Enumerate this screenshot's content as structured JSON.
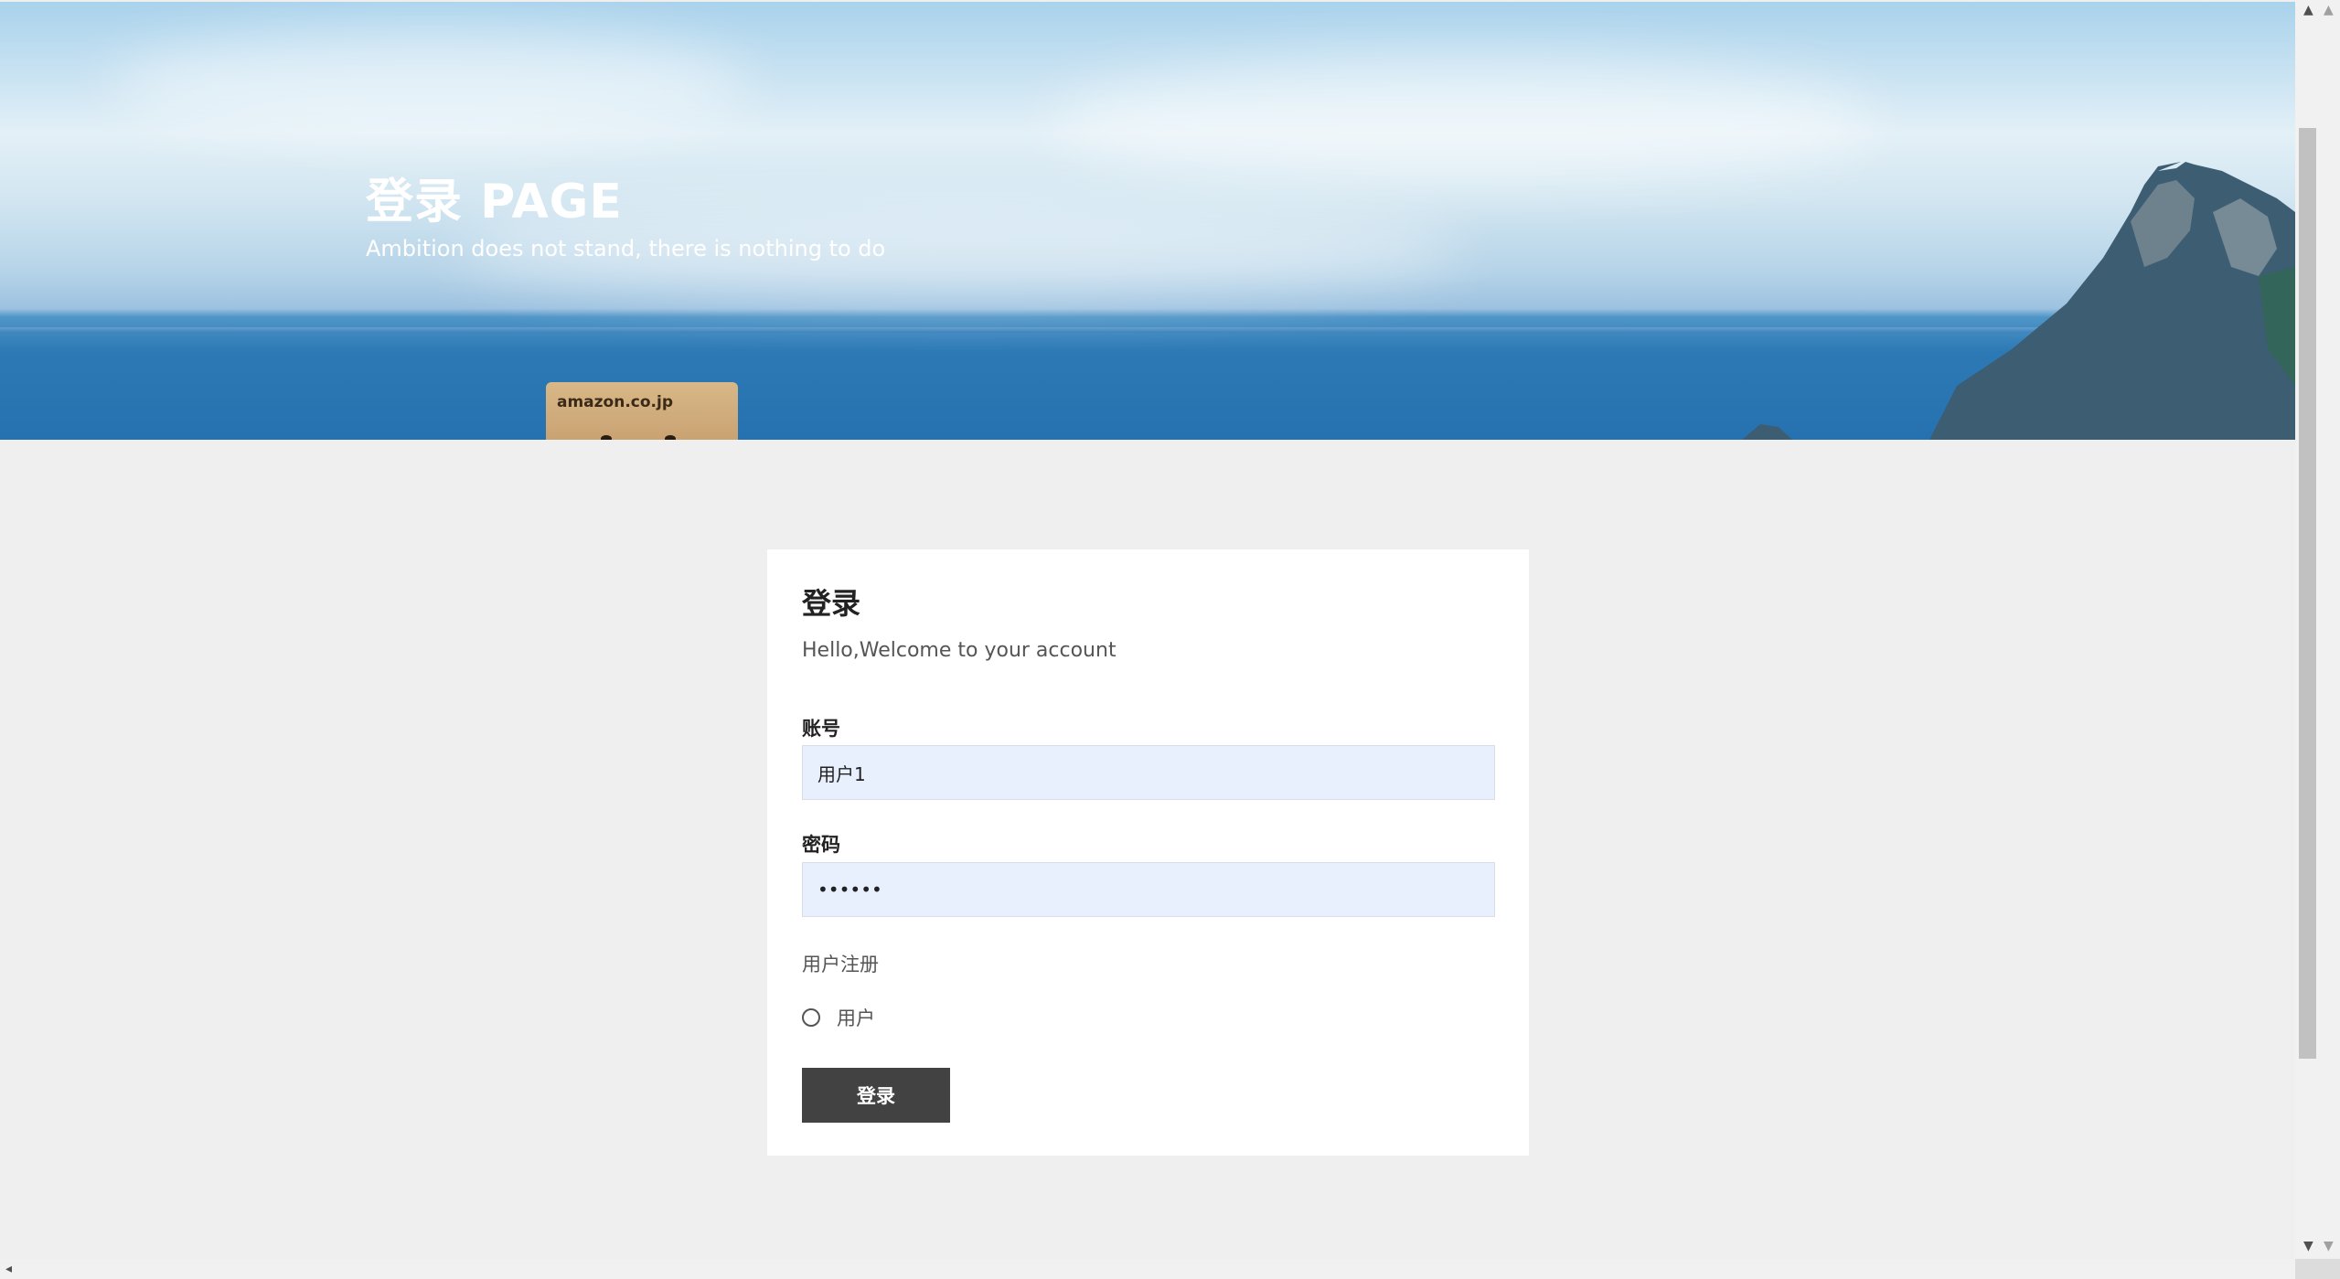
{
  "banner": {
    "title": "登录 PAGE",
    "subtitle": "Ambition does not stand, there is nothing to do",
    "box_label": "amazon.co.jp"
  },
  "login_card": {
    "title": "登录",
    "subtitle": "Hello,Welcome to your account",
    "account": {
      "label": "账号",
      "value": "用户1"
    },
    "password": {
      "label": "密码",
      "value": "••••••"
    },
    "register_link": "用户注册",
    "role_option": {
      "label": "用户",
      "selected": false
    },
    "submit_label": "登录"
  },
  "colors": {
    "page_background": "#efefef",
    "card_background": "#ffffff",
    "input_background": "#e8f0fe",
    "button_background": "#424242"
  }
}
